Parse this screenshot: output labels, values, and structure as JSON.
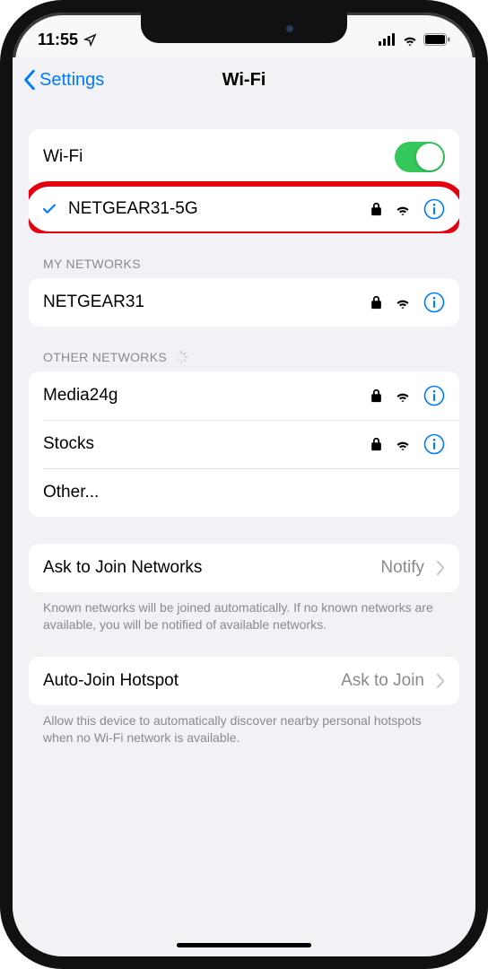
{
  "status_bar": {
    "time": "11:55"
  },
  "nav": {
    "back_label": "Settings",
    "title": "Wi-Fi"
  },
  "wifi_toggle": {
    "label": "Wi-Fi",
    "on": true
  },
  "connected_network": {
    "name": "NETGEAR31-5G",
    "secured": true
  },
  "sections": {
    "my_networks": {
      "header": "MY NETWORKS",
      "items": [
        {
          "name": "NETGEAR31",
          "secured": true
        }
      ]
    },
    "other_networks": {
      "header": "OTHER NETWORKS",
      "loading": true,
      "items": [
        {
          "name": "Media24g",
          "secured": true
        },
        {
          "name": "Stocks",
          "secured": true
        }
      ],
      "other_label": "Other..."
    }
  },
  "ask_to_join": {
    "label": "Ask to Join Networks",
    "value": "Notify",
    "footer": "Known networks will be joined automatically. If no known networks are available, you will be notified of available networks."
  },
  "auto_join": {
    "label": "Auto-Join Hotspot",
    "value": "Ask to Join",
    "footer": "Allow this device to automatically discover nearby personal hotspots when no Wi-Fi network is available."
  },
  "colors": {
    "link": "#007aff",
    "toggle_on": "#34c759",
    "highlight": "#e3000f"
  }
}
